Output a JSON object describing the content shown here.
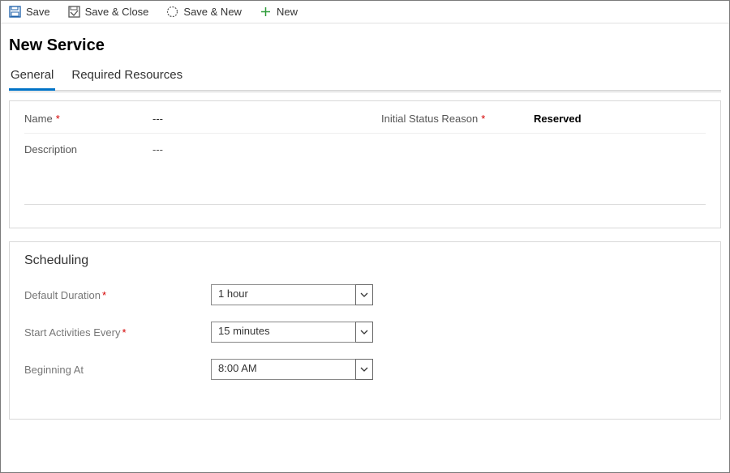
{
  "toolbar": {
    "save": "Save",
    "save_close": "Save & Close",
    "save_new": "Save & New",
    "new": "New"
  },
  "title": "New Service",
  "tabs": {
    "general": "General",
    "required_resources": "Required Resources"
  },
  "fields": {
    "name_label": "Name",
    "name_value": "---",
    "initial_status_label": "Initial Status Reason",
    "initial_status_value": "Reserved",
    "description_label": "Description",
    "description_value": "---"
  },
  "scheduling": {
    "title": "Scheduling",
    "default_duration_label": "Default Duration",
    "default_duration_value": "1 hour",
    "start_activities_label": "Start Activities Every",
    "start_activities_value": "15 minutes",
    "beginning_at_label": "Beginning At",
    "beginning_at_value": "8:00 AM"
  }
}
